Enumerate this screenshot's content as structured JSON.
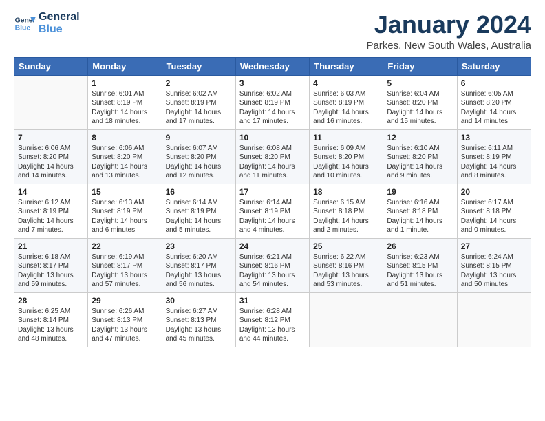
{
  "logo": {
    "line1": "General",
    "line2": "Blue"
  },
  "title": "January 2024",
  "subtitle": "Parkes, New South Wales, Australia",
  "weekdays": [
    "Sunday",
    "Monday",
    "Tuesday",
    "Wednesday",
    "Thursday",
    "Friday",
    "Saturday"
  ],
  "weeks": [
    [
      {
        "day": "",
        "info": ""
      },
      {
        "day": "1",
        "info": "Sunrise: 6:01 AM\nSunset: 8:19 PM\nDaylight: 14 hours\nand 18 minutes."
      },
      {
        "day": "2",
        "info": "Sunrise: 6:02 AM\nSunset: 8:19 PM\nDaylight: 14 hours\nand 17 minutes."
      },
      {
        "day": "3",
        "info": "Sunrise: 6:02 AM\nSunset: 8:19 PM\nDaylight: 14 hours\nand 17 minutes."
      },
      {
        "day": "4",
        "info": "Sunrise: 6:03 AM\nSunset: 8:19 PM\nDaylight: 14 hours\nand 16 minutes."
      },
      {
        "day": "5",
        "info": "Sunrise: 6:04 AM\nSunset: 8:20 PM\nDaylight: 14 hours\nand 15 minutes."
      },
      {
        "day": "6",
        "info": "Sunrise: 6:05 AM\nSunset: 8:20 PM\nDaylight: 14 hours\nand 14 minutes."
      }
    ],
    [
      {
        "day": "7",
        "info": "Sunrise: 6:06 AM\nSunset: 8:20 PM\nDaylight: 14 hours\nand 14 minutes."
      },
      {
        "day": "8",
        "info": "Sunrise: 6:06 AM\nSunset: 8:20 PM\nDaylight: 14 hours\nand 13 minutes."
      },
      {
        "day": "9",
        "info": "Sunrise: 6:07 AM\nSunset: 8:20 PM\nDaylight: 14 hours\nand 12 minutes."
      },
      {
        "day": "10",
        "info": "Sunrise: 6:08 AM\nSunset: 8:20 PM\nDaylight: 14 hours\nand 11 minutes."
      },
      {
        "day": "11",
        "info": "Sunrise: 6:09 AM\nSunset: 8:20 PM\nDaylight: 14 hours\nand 10 minutes."
      },
      {
        "day": "12",
        "info": "Sunrise: 6:10 AM\nSunset: 8:20 PM\nDaylight: 14 hours\nand 9 minutes."
      },
      {
        "day": "13",
        "info": "Sunrise: 6:11 AM\nSunset: 8:19 PM\nDaylight: 14 hours\nand 8 minutes."
      }
    ],
    [
      {
        "day": "14",
        "info": "Sunrise: 6:12 AM\nSunset: 8:19 PM\nDaylight: 14 hours\nand 7 minutes."
      },
      {
        "day": "15",
        "info": "Sunrise: 6:13 AM\nSunset: 8:19 PM\nDaylight: 14 hours\nand 6 minutes."
      },
      {
        "day": "16",
        "info": "Sunrise: 6:14 AM\nSunset: 8:19 PM\nDaylight: 14 hours\nand 5 minutes."
      },
      {
        "day": "17",
        "info": "Sunrise: 6:14 AM\nSunset: 8:19 PM\nDaylight: 14 hours\nand 4 minutes."
      },
      {
        "day": "18",
        "info": "Sunrise: 6:15 AM\nSunset: 8:18 PM\nDaylight: 14 hours\nand 2 minutes."
      },
      {
        "day": "19",
        "info": "Sunrise: 6:16 AM\nSunset: 8:18 PM\nDaylight: 14 hours\nand 1 minute."
      },
      {
        "day": "20",
        "info": "Sunrise: 6:17 AM\nSunset: 8:18 PM\nDaylight: 14 hours\nand 0 minutes."
      }
    ],
    [
      {
        "day": "21",
        "info": "Sunrise: 6:18 AM\nSunset: 8:17 PM\nDaylight: 13 hours\nand 59 minutes."
      },
      {
        "day": "22",
        "info": "Sunrise: 6:19 AM\nSunset: 8:17 PM\nDaylight: 13 hours\nand 57 minutes."
      },
      {
        "day": "23",
        "info": "Sunrise: 6:20 AM\nSunset: 8:17 PM\nDaylight: 13 hours\nand 56 minutes."
      },
      {
        "day": "24",
        "info": "Sunrise: 6:21 AM\nSunset: 8:16 PM\nDaylight: 13 hours\nand 54 minutes."
      },
      {
        "day": "25",
        "info": "Sunrise: 6:22 AM\nSunset: 8:16 PM\nDaylight: 13 hours\nand 53 minutes."
      },
      {
        "day": "26",
        "info": "Sunrise: 6:23 AM\nSunset: 8:15 PM\nDaylight: 13 hours\nand 51 minutes."
      },
      {
        "day": "27",
        "info": "Sunrise: 6:24 AM\nSunset: 8:15 PM\nDaylight: 13 hours\nand 50 minutes."
      }
    ],
    [
      {
        "day": "28",
        "info": "Sunrise: 6:25 AM\nSunset: 8:14 PM\nDaylight: 13 hours\nand 48 minutes."
      },
      {
        "day": "29",
        "info": "Sunrise: 6:26 AM\nSunset: 8:13 PM\nDaylight: 13 hours\nand 47 minutes."
      },
      {
        "day": "30",
        "info": "Sunrise: 6:27 AM\nSunset: 8:13 PM\nDaylight: 13 hours\nand 45 minutes."
      },
      {
        "day": "31",
        "info": "Sunrise: 6:28 AM\nSunset: 8:12 PM\nDaylight: 13 hours\nand 44 minutes."
      },
      {
        "day": "",
        "info": ""
      },
      {
        "day": "",
        "info": ""
      },
      {
        "day": "",
        "info": ""
      }
    ]
  ]
}
